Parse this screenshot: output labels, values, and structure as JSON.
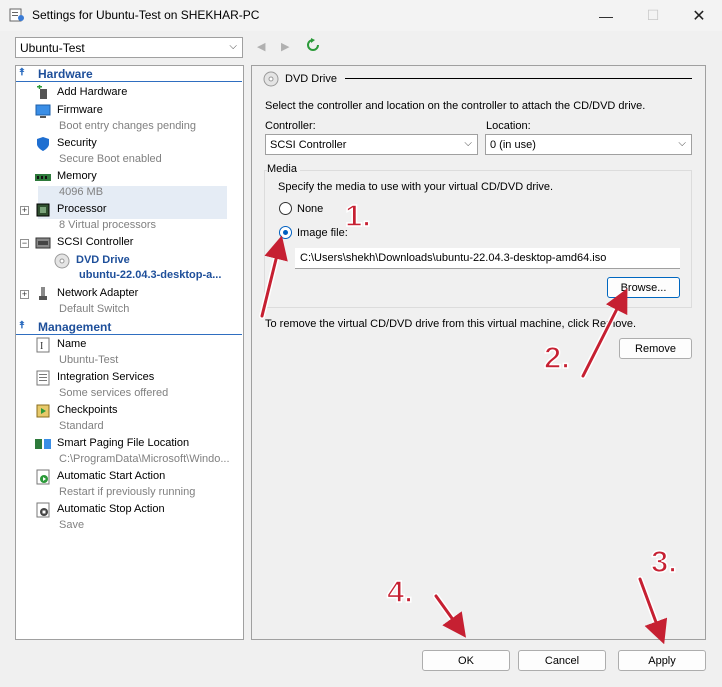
{
  "window": {
    "title": "Settings for Ubuntu-Test on SHEKHAR-PC",
    "minimize_icon": "minimize-icon",
    "maximize_icon": "maximize-icon",
    "close_icon": "close-icon"
  },
  "vm_selector": {
    "value": "Ubuntu-Test"
  },
  "tree": {
    "hardware": {
      "title": "Hardware",
      "items": [
        {
          "label": "Add Hardware",
          "sub": "",
          "icon": "add-hardware-icon"
        },
        {
          "label": "Firmware",
          "sub": "Boot entry changes pending",
          "icon": "firmware-icon"
        },
        {
          "label": "Security",
          "sub": "Secure Boot enabled",
          "icon": "shield-icon"
        },
        {
          "label": "Memory",
          "sub": "4096 MB",
          "icon": "memory-icon"
        },
        {
          "label": "Processor",
          "sub": "8 Virtual processors",
          "icon": "processor-icon"
        },
        {
          "label": "SCSI Controller",
          "sub": "",
          "icon": "scsi-icon"
        },
        {
          "label": "DVD Drive",
          "sub": "ubuntu-22.04.3-desktop-a...",
          "icon": "disc-icon"
        },
        {
          "label": "Network Adapter",
          "sub": "Default Switch",
          "icon": "network-icon"
        }
      ]
    },
    "management": {
      "title": "Management",
      "items": [
        {
          "label": "Name",
          "sub": "Ubuntu-Test",
          "icon": "name-icon"
        },
        {
          "label": "Integration Services",
          "sub": "Some services offered",
          "icon": "integration-icon"
        },
        {
          "label": "Checkpoints",
          "sub": "Standard",
          "icon": "checkpoint-icon"
        },
        {
          "label": "Smart Paging File Location",
          "sub": "C:\\ProgramData\\Microsoft\\Windo...",
          "icon": "paging-icon"
        },
        {
          "label": "Automatic Start Action",
          "sub": "Restart if previously running",
          "icon": "start-action-icon"
        },
        {
          "label": "Automatic Stop Action",
          "sub": "Save",
          "icon": "stop-action-icon"
        }
      ]
    }
  },
  "dvd": {
    "title": "DVD Drive",
    "description": "Select the controller and location on the controller to attach the CD/DVD drive.",
    "controller_label": "Controller:",
    "controller_value": "SCSI Controller",
    "location_label": "Location:",
    "location_value": "0 (in use)",
    "media_title": "Media",
    "media_description": "Specify the media to use with your virtual CD/DVD drive.",
    "none_label": "None",
    "image_label": "Image file:",
    "image_path": "C:\\Users\\shekh\\Downloads\\ubuntu-22.04.3-desktop-amd64.iso",
    "browse_label": "Browse...",
    "remove_text": "To remove the virtual CD/DVD drive from this virtual machine, click Remove.",
    "remove_label": "Remove"
  },
  "footer": {
    "ok": "OK",
    "cancel": "Cancel",
    "apply": "Apply"
  },
  "annotations": {
    "a1": "1.",
    "a2": "2.",
    "a3": "3.",
    "a4": "4."
  },
  "colors": {
    "accent": "#2f6ec0",
    "annotation": "#c62032",
    "selection": "#e5ecf5"
  }
}
